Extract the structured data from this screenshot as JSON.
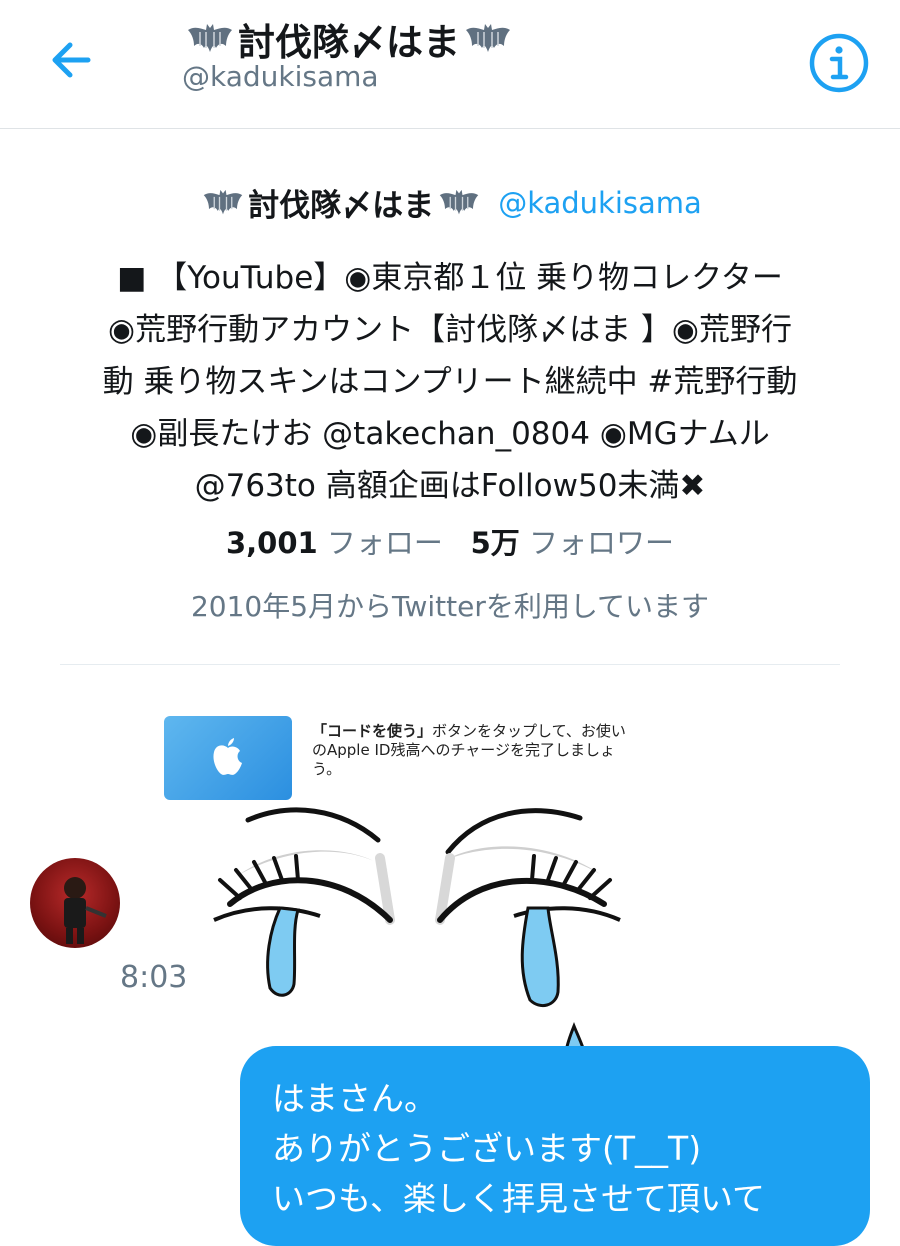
{
  "header": {
    "title": "討伐隊〆はま",
    "handle": "@kadukisama"
  },
  "profile": {
    "name": "討伐隊〆はま",
    "handle": "@kadukisama",
    "bio_lines": [
      "■ 【YouTube】◉東京都１位 乗り物コレクター",
      "◉荒野行動アカウント【討伐隊〆はま 】◉荒野行",
      "動 乗り物スキンはコンプリート継続中 #荒野行動",
      "◉副長たけお @takechan_0804 ◉MGナムル",
      "@763to 高額企画はFollow50未満✖"
    ],
    "following_count": "3,001",
    "following_label": "フォロー",
    "followers_count": "5万",
    "followers_label": "フォロワー",
    "joined": "2010年5月からTwitterを利用しています"
  },
  "card": {
    "bold_text": "「コードを使う」",
    "text": "ボタンをタップして、お使いのApple ID残高へのチャージを完了しましょう。"
  },
  "message": {
    "time": "8:03",
    "lines": [
      "はまさん。",
      "ありがとうございます(T__T)",
      "いつも、楽しく拝見させて頂いて"
    ]
  },
  "colors": {
    "accent": "#1da1f2",
    "muted": "#657786",
    "text": "#14171a"
  },
  "icons": [
    "back-arrow-icon",
    "info-icon",
    "bat-icon",
    "apple-logo-icon"
  ]
}
